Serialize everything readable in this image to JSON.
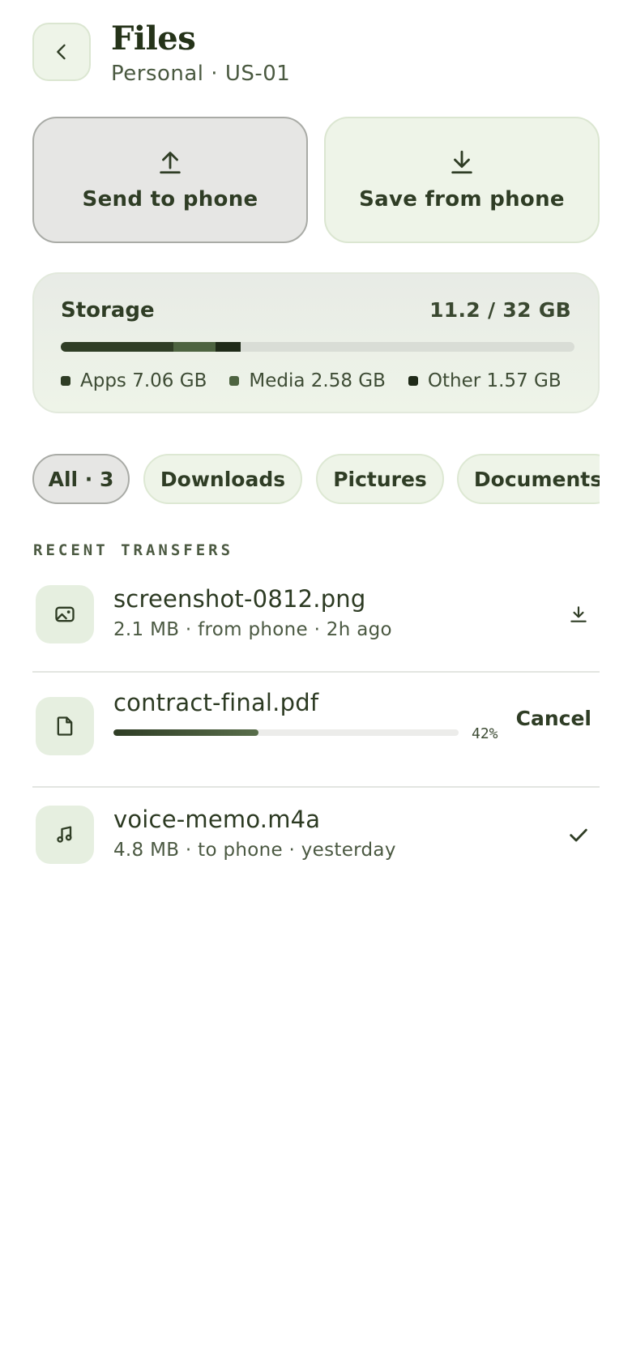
{
  "header": {
    "title": "Files",
    "subtitle": "Personal · US-01"
  },
  "actions": {
    "send_label": "Send to phone",
    "save_label": "Save from phone"
  },
  "storage": {
    "title": "Storage",
    "total": "11.2 / 32 GB",
    "segments": [
      {
        "name": "Apps",
        "label": "Apps 7.06 GB",
        "fraction": 0.22,
        "color": "#2f3d25"
      },
      {
        "name": "Media",
        "label": "Media 2.58 GB",
        "fraction": 0.0806,
        "color": "#4d6340"
      },
      {
        "name": "Other",
        "label": "Other 1.57 GB",
        "fraction": 0.049,
        "color": "#1f2a18"
      }
    ],
    "track_color": "#d9ddd6"
  },
  "filters": [
    {
      "label": "All · 3",
      "active": true
    },
    {
      "label": "Downloads",
      "active": false
    },
    {
      "label": "Pictures",
      "active": false
    },
    {
      "label": "Documents",
      "active": false
    }
  ],
  "section_label": "RECENT TRANSFERS",
  "transfers": [
    {
      "icon": "image-icon",
      "name": "screenshot-0812.png",
      "meta": "2.1 MB · from phone · 2h ago",
      "trailing_icon": "download-icon"
    },
    {
      "icon": "file-icon",
      "name": "contract-final.pdf",
      "progress": 0.42,
      "progress_label": "42%",
      "action_label": "Cancel"
    },
    {
      "icon": "music-note-icon",
      "name": "voice-memo.m4a",
      "meta": "4.8 MB · to phone · yesterday",
      "trailing_icon": "check-icon"
    }
  ],
  "colors": {
    "accent": "#2f3d25",
    "surface": "#eef4e8",
    "active_surface": "#e6e6e4"
  }
}
